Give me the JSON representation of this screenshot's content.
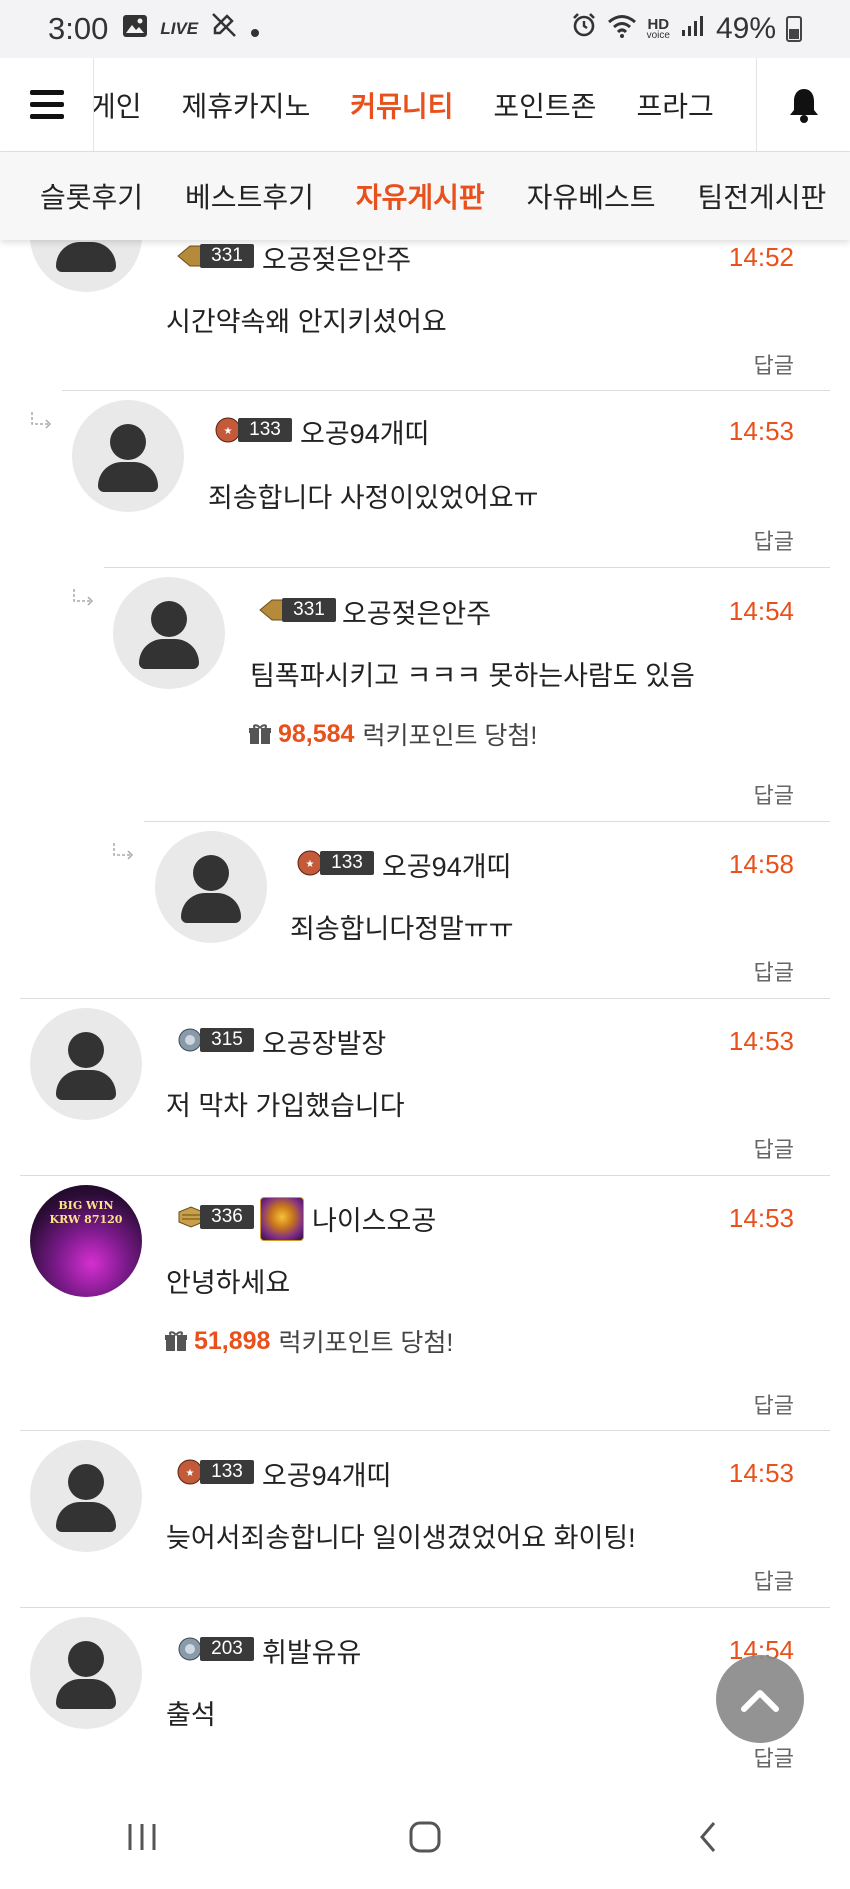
{
  "status_bar": {
    "time": "3:00",
    "live_label": "LIVE",
    "hd_label": "HD",
    "voice_label": "voice",
    "battery": "49%"
  },
  "top_nav": {
    "items": [
      {
        "label": "게인",
        "active": false
      },
      {
        "label": "제휴카지노",
        "active": false
      },
      {
        "label": "커뮤니티",
        "active": true
      },
      {
        "label": "포인트존",
        "active": false
      },
      {
        "label": "프라그",
        "active": false
      }
    ]
  },
  "sub_nav": {
    "items": [
      {
        "label": "슬롯후기",
        "active": false
      },
      {
        "label": "베스트후기",
        "active": false
      },
      {
        "label": "자유게시판",
        "active": true
      },
      {
        "label": "자유베스트",
        "active": false
      },
      {
        "label": "팀전게시판",
        "active": false
      }
    ]
  },
  "reply_label": "답글",
  "lucky_suffix": "럭키포인트 당첨!",
  "comments": [
    {
      "level": "331",
      "user": "오공젖은안주",
      "time": "14:52",
      "text": "시간약속왜 안지키셨어요",
      "depth": 0
    },
    {
      "level": "133",
      "user": "오공94개띠",
      "time": "14:53",
      "text": "죄송합니다 사정이있었어요ㅠ",
      "depth": 1
    },
    {
      "level": "331",
      "user": "오공젖은안주",
      "time": "14:54",
      "text": "팀폭파시키고 ㅋㅋㅋ 못하는사람도 있음",
      "lucky_points": "98,584",
      "depth": 2
    },
    {
      "level": "133",
      "user": "오공94개띠",
      "time": "14:58",
      "text": "죄송합니다정말ㅠㅠ",
      "depth": 3
    },
    {
      "level": "315",
      "user": "오공장발장",
      "time": "14:53",
      "text": "저 막차 가입했습니다",
      "depth": 0
    },
    {
      "level": "336",
      "user": "나이스오공",
      "time": "14:53",
      "text": "안녕하세요",
      "lucky_points": "51,898",
      "avatar_text_1": "BIG WIN",
      "avatar_text_2": "KRW 87120",
      "depth": 0
    },
    {
      "level": "133",
      "user": "오공94개띠",
      "time": "14:53",
      "text": "늦어서죄송합니다 일이생겼었어요 화이팅!",
      "depth": 0
    },
    {
      "level": "203",
      "user": "휘발유유",
      "time": "14:54",
      "text": "출석",
      "depth": 0
    }
  ],
  "colors": {
    "accent": "#e8501c",
    "badge_bg": "#3a3a3a",
    "avatar_bg": "#e9e9e9"
  },
  "icons": [
    "menu-icon",
    "bell-icon",
    "reply-arrow-icon",
    "gift-icon",
    "scroll-top-icon",
    "recent-apps-icon",
    "home-icon",
    "back-icon"
  ]
}
